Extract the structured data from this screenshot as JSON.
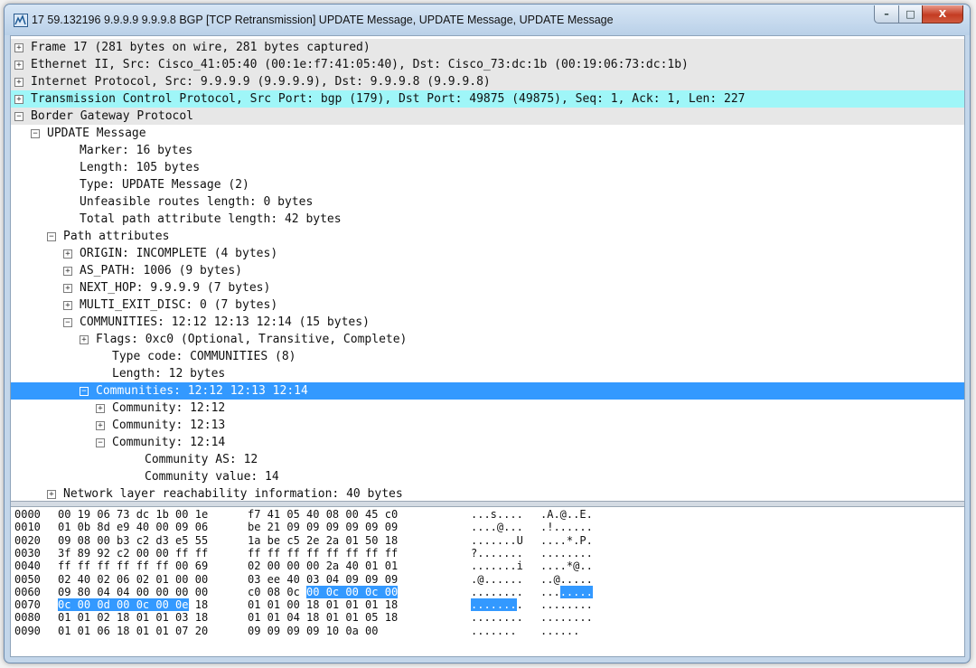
{
  "window": {
    "title": "17 59.132196 9.9.9.9 9.9.9.8 BGP [TCP Retransmission] UPDATE Message, UPDATE Message, UPDATE Message",
    "controls": {
      "minimize": "–",
      "maximize": "□",
      "close": "X"
    }
  },
  "colors": {
    "selected": "#3399ff",
    "tcp_row": "#9ff6f8",
    "header_row": "#e7e7e7"
  },
  "detail": [
    {
      "text": "Frame 17 (281 bytes on wire, 281 bytes captured)",
      "expander": "+"
    },
    {
      "text": "Ethernet II, Src: Cisco_41:05:40 (00:1e:f7:41:05:40), Dst: Cisco_73:dc:1b (00:19:06:73:dc:1b)",
      "expander": "+"
    },
    {
      "text": "Internet Protocol, Src: 9.9.9.9 (9.9.9.9), Dst: 9.9.9.8 (9.9.9.8)",
      "expander": "+"
    },
    {
      "text": "Transmission Control Protocol, Src Port: bgp (179), Dst Port: 49875 (49875), Seq: 1, Ack: 1, Len: 227",
      "expander": "+"
    },
    {
      "text": "Border Gateway Protocol",
      "expander": "−"
    },
    {
      "text": "UPDATE Message",
      "expander": "−"
    },
    {
      "text": "Marker: 16 bytes",
      "expander": ""
    },
    {
      "text": "Length: 105 bytes",
      "expander": ""
    },
    {
      "text": "Type: UPDATE Message (2)",
      "expander": ""
    },
    {
      "text": "Unfeasible routes length: 0 bytes",
      "expander": ""
    },
    {
      "text": "Total path attribute length: 42 bytes",
      "expander": ""
    },
    {
      "text": "Path attributes",
      "expander": "−"
    },
    {
      "text": "ORIGIN: INCOMPLETE (4 bytes)",
      "expander": "+"
    },
    {
      "text": "AS_PATH: 1006 (9 bytes)",
      "expander": "+"
    },
    {
      "text": "NEXT_HOP: 9.9.9.9 (7 bytes)",
      "expander": "+"
    },
    {
      "text": "MULTI_EXIT_DISC: 0 (7 bytes)",
      "expander": "+"
    },
    {
      "text": "COMMUNITIES: 12:12 12:13 12:14 (15 bytes)",
      "expander": "−"
    },
    {
      "text": "Flags: 0xc0 (Optional, Transitive, Complete)",
      "expander": "+"
    },
    {
      "text": "Type code: COMMUNITIES (8)",
      "expander": ""
    },
    {
      "text": "Length: 12 bytes",
      "expander": ""
    },
    {
      "text": "Communities: 12:12 12:13 12:14",
      "expander": "−"
    },
    {
      "text": "Community: 12:12",
      "expander": "+"
    },
    {
      "text": "Community: 12:13",
      "expander": "+"
    },
    {
      "text": "Community: 12:14",
      "expander": "−"
    },
    {
      "text": "Community AS: 12",
      "expander": ""
    },
    {
      "text": "Community value: 14",
      "expander": ""
    },
    {
      "text": "Network layer reachability information: 40 bytes",
      "expander": "+"
    }
  ],
  "hex": [
    {
      "offset": "0000",
      "b1": "00 19 06 73 dc 1b 00 1e",
      "b2": "f7 41 05 40 08 00 45 c0",
      "a1": "...s....",
      "a2": ".A.@..E."
    },
    {
      "offset": "0010",
      "b1": "01 0b 8d e9 40 00 09 06",
      "b2": "be 21 09 09 09 09 09 09",
      "a1": "....@...",
      "a2": ".!......"
    },
    {
      "offset": "0020",
      "b1": "09 08 00 b3 c2 d3 e5 55",
      "b2": "1a be c5 2e 2a 01 50 18",
      "a1": ".......U",
      "a2": "....*.P."
    },
    {
      "offset": "0030",
      "b1": "3f 89 92 c2 00 00 ff ff",
      "b2": "ff ff ff ff ff ff ff ff",
      "a1": "?.......",
      "a2": "........"
    },
    {
      "offset": "0040",
      "b1": "ff ff ff ff ff ff 00 69",
      "b2": "02 00 00 00 2a 40 01 01",
      "a1": ".......i",
      "a2": "....*@.."
    },
    {
      "offset": "0050",
      "b1": "02 40 02 06 02 01 00 00",
      "b2": "03 ee 40 03 04 09 09 09",
      "a1": ".@......",
      "a2": "..@....."
    },
    {
      "offset": "0060",
      "b1": "09 80 04 04 00 00 00 00",
      "b2": "c0 08 0c",
      "b2h": "00 0c 00 0c 00",
      "a1": "........",
      "a2": "...",
      "a2h": "....."
    },
    {
      "offset": "0070",
      "b1h": "0c 00 0d 00 0c 00 0e",
      "b1": "18",
      "b2": "01 01 00 18 01 01 01 18",
      "a1h": ".......",
      "a1": ".",
      "a2": "........"
    },
    {
      "offset": "0080",
      "b1": "01 01 02 18 01 01 03 18",
      "b2": "01 01 04 18 01 01 05 18",
      "a1": "........",
      "a2": "........"
    },
    {
      "offset": "0090",
      "b1": "01 01 06 18 01 01 07 20",
      "b2": "09 09 09 09 10 0a 00",
      "a1": "....... ",
      "a2": "......"
    }
  ]
}
